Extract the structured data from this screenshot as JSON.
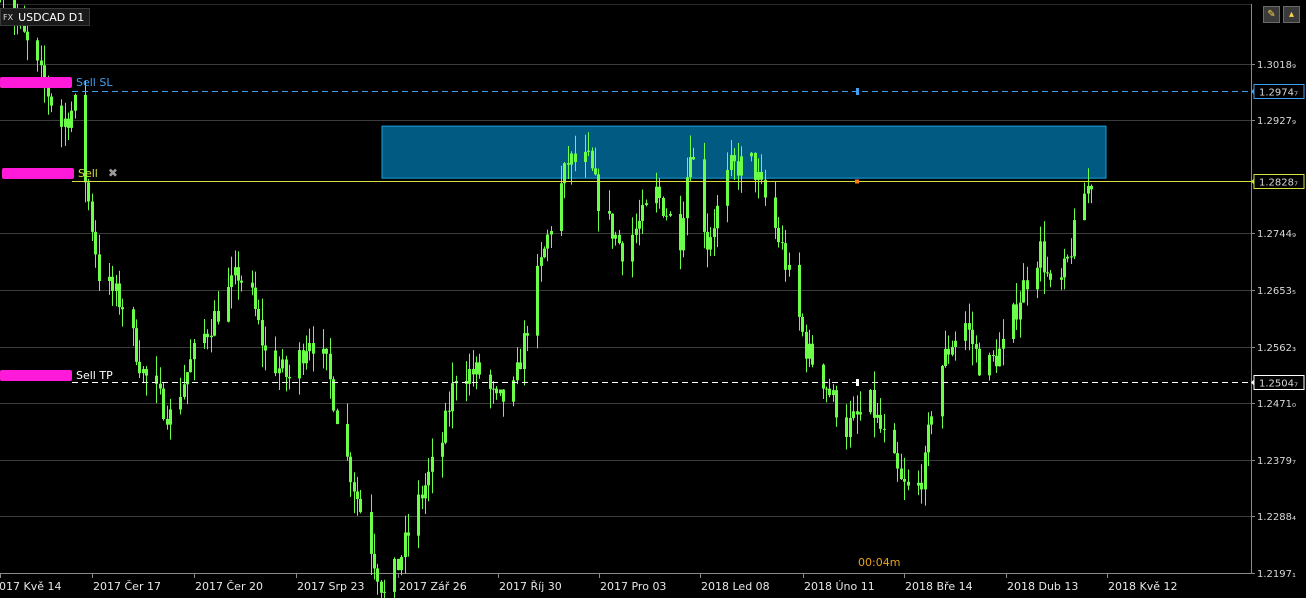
{
  "symbol": {
    "badge": "FX",
    "name": "USDCAD D1"
  },
  "countdown": "00:04m",
  "colors": {
    "background": "#000000",
    "candle": "#6cff4a",
    "grid": "#3c3c3c",
    "sl": "#3f9ff0",
    "entry": "#d6e13a",
    "tp": "#ffffff",
    "zone": "#005a82",
    "tag": "#ff19d9"
  },
  "orders": {
    "sl": {
      "label": "Sell  SL",
      "price": 1.29747,
      "price_label": "1.2974₇"
    },
    "entry": {
      "label": "Sell",
      "price": 1.28287,
      "price_label": "1.2828₇",
      "close_icon": "close-x-icon"
    },
    "tp": {
      "label": "Sell  TP",
      "price": 1.25047,
      "price_label": "1.2504₇"
    }
  },
  "corner_buttons": [
    "pencil-icon",
    "collapse-icon"
  ],
  "chart_data": {
    "type": "candlestick",
    "symbol": "USDCAD",
    "timeframe": "D1",
    "y_ticks": [
      {
        "value": 1.30189,
        "label": "1.3018₉"
      },
      {
        "value": 1.29279,
        "label": "1.2927₉"
      },
      {
        "value": 1.27449,
        "label": "1.2744₉"
      },
      {
        "value": 1.26535,
        "label": "1.2653₅"
      },
      {
        "value": 1.25623,
        "label": "1.2562₃"
      },
      {
        "value": 1.2471,
        "label": "1.2471₀"
      },
      {
        "value": 1.23797,
        "label": "1.2379₇"
      },
      {
        "value": 1.22884,
        "label": "1.2288₄"
      },
      {
        "value": 1.21971,
        "label": "1.2197₁"
      }
    ],
    "x_ticks": [
      "2017 Kvě 14",
      "2017 Čer 17",
      "2017 Čer 20",
      "2017 Srp 23",
      "2017 Zář 26",
      "2017 Říj 30",
      "2017 Pro 03",
      "2018 Led 08",
      "2018 Úno 11",
      "2018 Bře 14",
      "2018 Dub 13",
      "2018 Kvě 12"
    ],
    "x_range": [
      "2017-05-11",
      "2018-05-14"
    ],
    "ylim": [
      1.2197,
      1.3115
    ],
    "zone": {
      "from": "2017-09-26",
      "to": "2018-05-14",
      "low": 1.2834,
      "high": 1.2918
    },
    "closes": [
      {
        "date": "2017-05-11",
        "close": 1.315
      },
      {
        "date": "2017-05-22",
        "close": 1.301
      },
      {
        "date": "2017-05-29",
        "close": 1.292
      },
      {
        "date": "2017-06-02",
        "close": 1.295
      },
      {
        "date": "2017-06-09",
        "close": 1.268
      },
      {
        "date": "2017-06-16",
        "close": 1.263
      },
      {
        "date": "2017-06-22",
        "close": 1.252
      },
      {
        "date": "2017-06-30",
        "close": 1.245
      },
      {
        "date": "2017-07-07",
        "close": 1.255
      },
      {
        "date": "2017-07-13",
        "close": 1.261
      },
      {
        "date": "2017-07-20",
        "close": 1.268
      },
      {
        "date": "2017-07-24",
        "close": 1.264
      },
      {
        "date": "2017-07-28",
        "close": 1.255
      },
      {
        "date": "2017-08-04",
        "close": 1.251
      },
      {
        "date": "2017-08-10",
        "close": 1.258
      },
      {
        "date": "2017-08-15",
        "close": 1.253
      },
      {
        "date": "2017-08-21",
        "close": 1.238
      },
      {
        "date": "2017-08-28",
        "close": 1.224
      },
      {
        "date": "2017-09-01",
        "close": 1.216
      },
      {
        "date": "2017-09-05",
        "close": 1.221
      },
      {
        "date": "2017-09-11",
        "close": 1.231
      },
      {
        "date": "2017-09-18",
        "close": 1.241
      },
      {
        "date": "2017-09-22",
        "close": 1.252
      },
      {
        "date": "2017-09-29",
        "close": 1.252
      },
      {
        "date": "2017-10-04",
        "close": 1.247
      },
      {
        "date": "2017-10-09",
        "close": 1.249
      },
      {
        "date": "2017-10-15",
        "close": 1.265
      },
      {
        "date": "2017-10-20",
        "close": 1.276
      },
      {
        "date": "2017-10-25",
        "close": 1.286
      },
      {
        "date": "2017-10-31",
        "close": 1.286
      },
      {
        "date": "2017-11-04",
        "close": 1.278
      },
      {
        "date": "2017-11-10",
        "close": 1.272
      },
      {
        "date": "2017-11-15",
        "close": 1.276
      },
      {
        "date": "2017-11-20",
        "close": 1.281
      },
      {
        "date": "2017-11-27",
        "close": 1.274
      },
      {
        "date": "2017-11-30",
        "close": 1.289
      },
      {
        "date": "2017-12-05",
        "close": 1.273
      },
      {
        "date": "2017-12-12",
        "close": 1.285
      },
      {
        "date": "2017-12-18",
        "close": 1.286
      },
      {
        "date": "2017-12-22",
        "close": 1.28
      },
      {
        "date": "2017-12-27",
        "close": 1.272
      },
      {
        "date": "2018-01-03",
        "close": 1.256
      },
      {
        "date": "2018-01-09",
        "close": 1.25
      },
      {
        "date": "2018-01-15",
        "close": 1.243
      },
      {
        "date": "2018-01-22",
        "close": 1.247
      },
      {
        "date": "2018-01-27",
        "close": 1.24
      },
      {
        "date": "2018-01-31",
        "close": 1.234
      },
      {
        "date": "2018-02-04",
        "close": 1.232
      },
      {
        "date": "2018-02-07",
        "close": 1.237
      },
      {
        "date": "2018-02-10",
        "close": 1.251
      },
      {
        "date": "2018-02-15",
        "close": 1.257
      },
      {
        "date": "2018-02-19",
        "close": 1.26
      },
      {
        "date": "2018-02-24",
        "close": 1.252
      },
      {
        "date": "2018-03-02",
        "close": 1.256
      },
      {
        "date": "2018-03-08",
        "close": 1.266
      },
      {
        "date": "2018-03-13",
        "close": 1.272
      },
      {
        "date": "2018-03-17",
        "close": 1.263
      },
      {
        "date": "2018-03-21",
        "close": 1.27
      },
      {
        "date": "2018-03-26",
        "close": 1.281
      },
      {
        "date": "2018-03-28",
        "close": 1.2829
      }
    ]
  }
}
